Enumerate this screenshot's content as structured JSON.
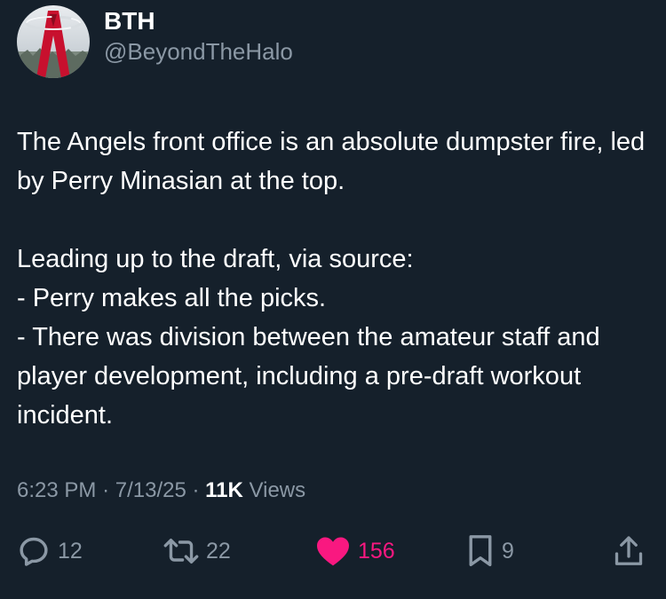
{
  "author": {
    "display_name": "BTH",
    "handle": "@BeyondTheHalo",
    "avatar_icon": "angels-logo-avatar"
  },
  "tweet": {
    "text": "The Angels front office is an absolute dumpster fire, led by Perry Minasian at the top.\n\nLeading up to the draft, via source:\n- Perry makes all the picks.\n- There was division between the amateur staff and player development, including a pre-draft workout incident."
  },
  "meta": {
    "time": "6:23 PM",
    "separator": "·",
    "date": "7/13/25",
    "views_count": "11K",
    "views_label": "Views"
  },
  "actions": {
    "reply": {
      "icon": "reply-icon",
      "count": "12"
    },
    "repost": {
      "icon": "repost-icon",
      "count": "22"
    },
    "like": {
      "icon": "heart-icon",
      "count": "156",
      "liked": true
    },
    "bookmark": {
      "icon": "bookmark-icon",
      "count": "9"
    },
    "share": {
      "icon": "share-icon"
    }
  },
  "colors": {
    "background": "#15202b",
    "text": "#ffffff",
    "secondary": "#8b98a5",
    "like": "#f91880",
    "avatar_red": "#c8102e"
  }
}
